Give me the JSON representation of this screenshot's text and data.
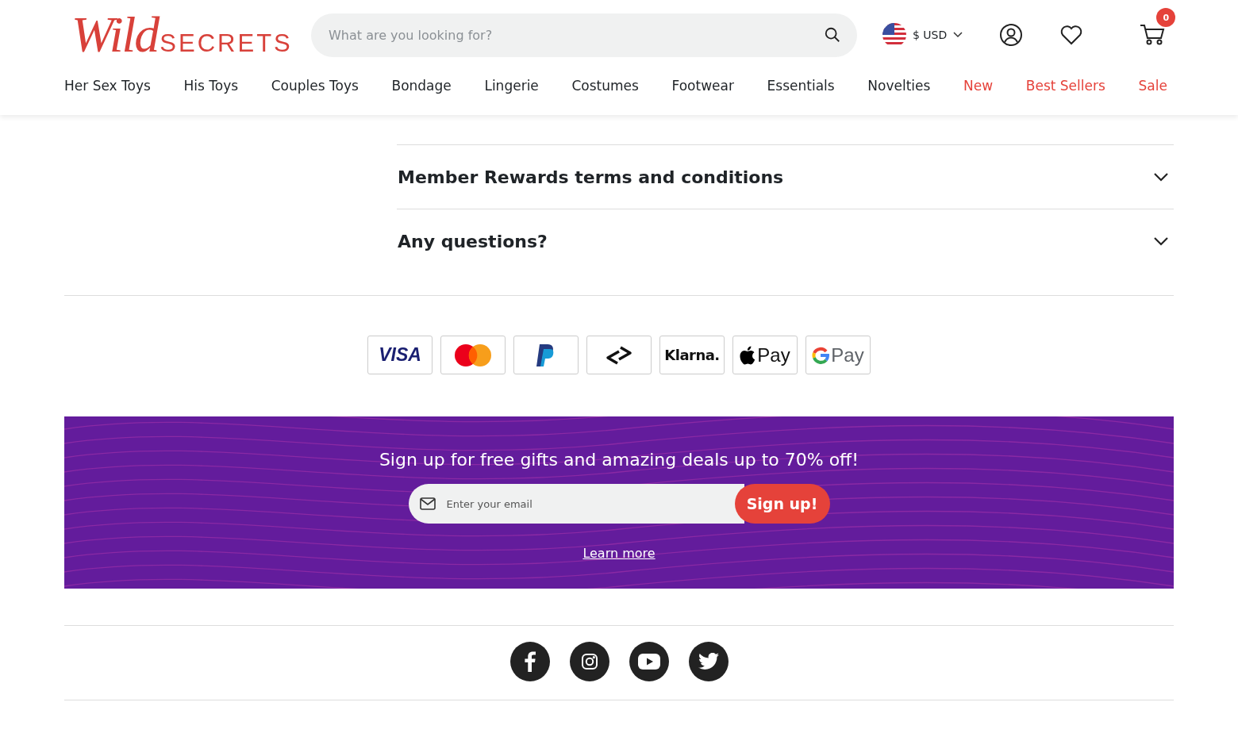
{
  "logo": {
    "script": "Wild",
    "caps": "SECRETS"
  },
  "search": {
    "placeholder": "What are you looking for?"
  },
  "currency": {
    "label": "$ USD"
  },
  "cart": {
    "count": "0"
  },
  "nav": [
    {
      "label": "Her Sex Toys",
      "highlight": false
    },
    {
      "label": "His Toys",
      "highlight": false
    },
    {
      "label": "Couples Toys",
      "highlight": false
    },
    {
      "label": "Bondage",
      "highlight": false
    },
    {
      "label": "Lingerie",
      "highlight": false
    },
    {
      "label": "Costumes",
      "highlight": false
    },
    {
      "label": "Footwear",
      "highlight": false
    },
    {
      "label": "Essentials",
      "highlight": false
    },
    {
      "label": "Novelties",
      "highlight": false
    },
    {
      "label": "New",
      "highlight": true
    },
    {
      "label": "Best Sellers",
      "highlight": true
    },
    {
      "label": "Sale",
      "highlight": true
    }
  ],
  "accordion": [
    {
      "title": "Member Rewards terms and conditions",
      "expanded": false
    },
    {
      "title": "Any questions?",
      "expanded": false
    }
  ],
  "payments": [
    {
      "kind": "visa",
      "label": "VISA"
    },
    {
      "kind": "mastercard"
    },
    {
      "kind": "paypal"
    },
    {
      "kind": "afterpay"
    },
    {
      "kind": "klarna",
      "label": "Klarna."
    },
    {
      "kind": "applepay",
      "label": "Pay"
    },
    {
      "kind": "googlepay",
      "label": "Pay"
    }
  ],
  "newsletter": {
    "heading": "Sign up for free gifts and amazing deals up to 70% off!",
    "placeholder": "Enter your email",
    "button": "Sign up!",
    "link": "Learn more"
  },
  "social": [
    {
      "kind": "facebook"
    },
    {
      "kind": "instagram"
    },
    {
      "kind": "youtube"
    },
    {
      "kind": "twitter"
    }
  ]
}
